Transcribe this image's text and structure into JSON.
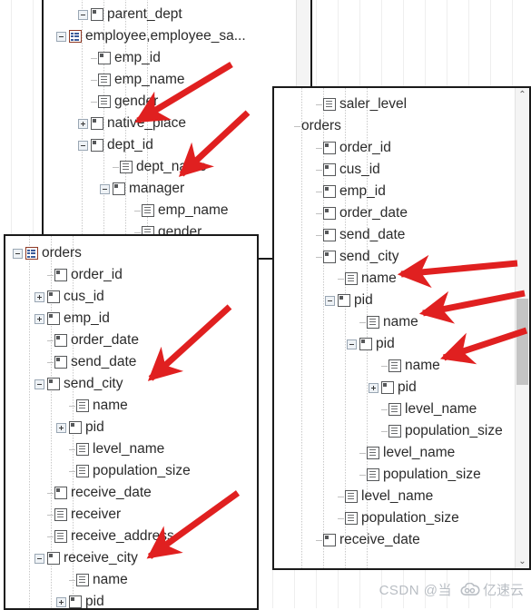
{
  "meta": {
    "accent_red": "#e02020",
    "table_icon_color": "#8f3a26",
    "column_icon_color": "#56585a",
    "text_color": "#2b2b2b",
    "panel_border": "#1a1a1a"
  },
  "panels": [
    {
      "name": "top-panel",
      "rows": [
        {
          "indent": 1,
          "expander": "minus",
          "icon": "column-key-icon",
          "label": "parent_dept",
          "clipped": true
        },
        {
          "indent": 0,
          "expander": "minus",
          "icon": "table-icon",
          "label": "employee,employee_sa..."
        },
        {
          "indent": 1,
          "expander": "none",
          "icon": "column-key-icon",
          "label": "emp_id"
        },
        {
          "indent": 1,
          "expander": "none",
          "icon": "column-text-icon",
          "label": "emp_name"
        },
        {
          "indent": 1,
          "expander": "none",
          "icon": "column-text-icon",
          "label": "gender"
        },
        {
          "indent": 1,
          "expander": "plus",
          "icon": "column-key-icon",
          "label": "native_place"
        },
        {
          "indent": 1,
          "expander": "minus",
          "icon": "column-key-icon",
          "label": "dept_id"
        },
        {
          "indent": 2,
          "expander": "none",
          "icon": "column-text-icon",
          "label": "dept_name"
        },
        {
          "indent": 2,
          "expander": "minus",
          "icon": "column-key-icon",
          "label": "manager"
        },
        {
          "indent": 3,
          "expander": "none",
          "icon": "column-text-icon",
          "label": "emp_name"
        },
        {
          "indent": 3,
          "expander": "none",
          "icon": "column-text-icon",
          "label": "gender"
        }
      ]
    },
    {
      "name": "left-panel",
      "rows": [
        {
          "indent": 0,
          "expander": "minus",
          "icon": "table-icon",
          "label": "orders"
        },
        {
          "indent": 1,
          "expander": "none",
          "icon": "column-key-icon",
          "label": "order_id"
        },
        {
          "indent": 1,
          "expander": "plus",
          "icon": "column-key-icon",
          "label": "cus_id"
        },
        {
          "indent": 1,
          "expander": "plus",
          "icon": "column-key-icon",
          "label": "emp_id"
        },
        {
          "indent": 1,
          "expander": "none",
          "icon": "column-key-icon",
          "label": "order_date"
        },
        {
          "indent": 1,
          "expander": "none",
          "icon": "column-key-icon",
          "label": "send_date"
        },
        {
          "indent": 1,
          "expander": "minus",
          "icon": "column-key-icon",
          "label": "send_city"
        },
        {
          "indent": 2,
          "expander": "none",
          "icon": "column-text-icon",
          "label": "name"
        },
        {
          "indent": 2,
          "expander": "plus",
          "icon": "column-key-icon",
          "label": "pid"
        },
        {
          "indent": 2,
          "expander": "none",
          "icon": "column-text-icon",
          "label": "level_name"
        },
        {
          "indent": 2,
          "expander": "none",
          "icon": "column-text-icon",
          "label": "population_size"
        },
        {
          "indent": 1,
          "expander": "none",
          "icon": "column-key-icon",
          "label": "receive_date"
        },
        {
          "indent": 1,
          "expander": "none",
          "icon": "column-text-icon",
          "label": "receiver"
        },
        {
          "indent": 1,
          "expander": "none",
          "icon": "column-text-icon",
          "label": "receive_address"
        },
        {
          "indent": 1,
          "expander": "minus",
          "icon": "column-key-icon",
          "label": "receive_city"
        },
        {
          "indent": 2,
          "expander": "none",
          "icon": "column-text-icon",
          "label": "name"
        },
        {
          "indent": 2,
          "expander": "plus",
          "icon": "column-key-icon",
          "label": "pid",
          "clipped": true
        }
      ]
    },
    {
      "name": "right-panel",
      "rows": [
        {
          "indent": 1,
          "expander": "none",
          "icon": "column-text-icon",
          "label": "saler_level"
        },
        {
          "indent": 0,
          "expander": "none",
          "icon": "none",
          "label": "orders"
        },
        {
          "indent": 1,
          "expander": "none",
          "icon": "column-key-icon",
          "label": "order_id"
        },
        {
          "indent": 1,
          "expander": "none",
          "icon": "column-key-icon",
          "label": "cus_id"
        },
        {
          "indent": 1,
          "expander": "none",
          "icon": "column-key-icon",
          "label": "emp_id"
        },
        {
          "indent": 1,
          "expander": "none",
          "icon": "column-key-icon",
          "label": "order_date"
        },
        {
          "indent": 1,
          "expander": "none",
          "icon": "column-key-icon",
          "label": "send_date"
        },
        {
          "indent": 1,
          "expander": "none",
          "icon": "column-key-icon",
          "label": "send_city"
        },
        {
          "indent": 2,
          "expander": "none",
          "icon": "column-text-icon",
          "label": "name"
        },
        {
          "indent": 2,
          "expander": "minus",
          "icon": "column-key-icon",
          "label": "pid"
        },
        {
          "indent": 3,
          "expander": "none",
          "icon": "column-text-icon",
          "label": "name"
        },
        {
          "indent": 3,
          "expander": "minus",
          "icon": "column-key-icon",
          "label": "pid"
        },
        {
          "indent": 4,
          "expander": "none",
          "icon": "column-text-icon",
          "label": "name"
        },
        {
          "indent": 4,
          "expander": "plus",
          "icon": "column-key-icon",
          "label": "pid"
        },
        {
          "indent": 4,
          "expander": "none",
          "icon": "column-text-icon",
          "label": "level_name"
        },
        {
          "indent": 4,
          "expander": "none",
          "icon": "column-text-icon",
          "label": "population_size"
        },
        {
          "indent": 3,
          "expander": "none",
          "icon": "column-text-icon",
          "label": "level_name"
        },
        {
          "indent": 3,
          "expander": "none",
          "icon": "column-text-icon",
          "label": "population_size"
        },
        {
          "indent": 2,
          "expander": "none",
          "icon": "column-text-icon",
          "label": "level_name"
        },
        {
          "indent": 2,
          "expander": "none",
          "icon": "column-text-icon",
          "label": "population_size"
        },
        {
          "indent": 1,
          "expander": "none",
          "icon": "column-key-icon",
          "label": "receive_date"
        }
      ]
    }
  ],
  "scrollbars": {
    "top_panel": {
      "up_glyph": "",
      "down_glyph": ""
    },
    "right_panel": {
      "up_glyph": "⌃",
      "down_glyph": "⌄"
    }
  },
  "annotations": {
    "arrow_count": 7,
    "targets": [
      "dept_id",
      "manager",
      "send_city",
      "receive_city",
      "name",
      "name",
      "name"
    ]
  },
  "watermark": {
    "csdn": "CSDN @当",
    "cloud_icon": "cloud-icon",
    "brand": "亿速云"
  }
}
